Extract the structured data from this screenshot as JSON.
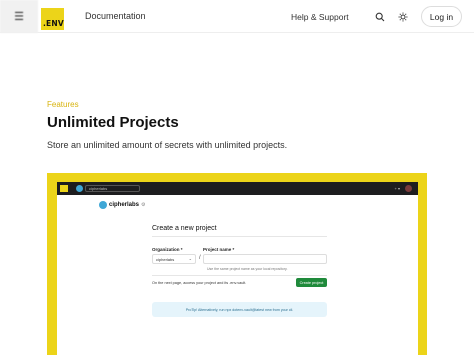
{
  "header": {
    "logo_text": ".ENV",
    "nav_docs": "Documentation",
    "nav_help": "Help & Support",
    "login_label": "Log in",
    "icons": [
      "menu-icon",
      "search-icon",
      "theme-toggle-icon"
    ]
  },
  "hero": {
    "eyebrow": "Features",
    "title": "Unlimited Projects",
    "subtitle": "Store an unlimited amount of secrets with unlimited projects."
  },
  "app_preview": {
    "top_select": "cipherlabs",
    "org_name": "cipherlabs",
    "card_title": "Create a new project",
    "org_label": "Organization *",
    "project_label": "Project name *",
    "org_value": "cipherlabs",
    "slash": "/",
    "hint": "Use the same project name as your local repository.",
    "next_text": "On the next page, access your project and its .env.vault.",
    "create_button": "Create project",
    "protip": "ProTip! Alternatively, run npx dotenv-vault@latest new from your cli."
  },
  "colors": {
    "brand_yellow": "#ecd419",
    "eyebrow": "#d8b40e",
    "create_green": "#1f8a3b"
  }
}
